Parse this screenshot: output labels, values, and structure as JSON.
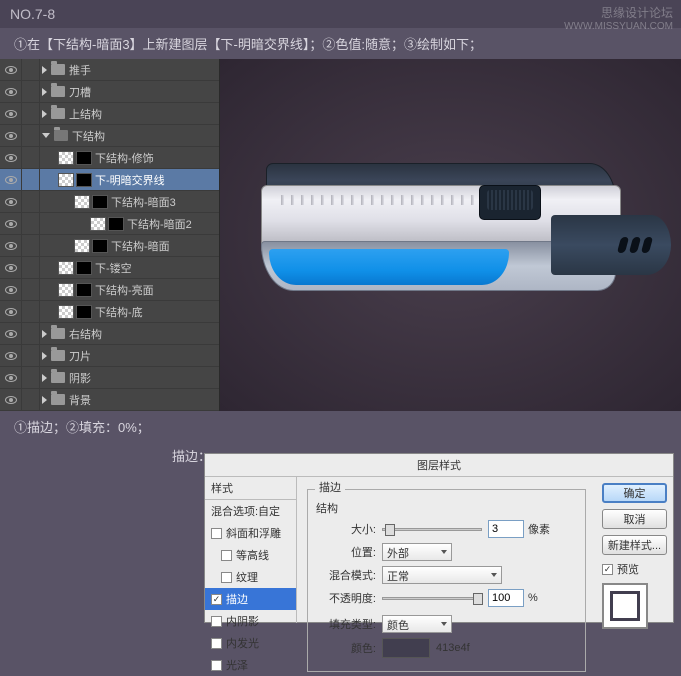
{
  "step_number": "NO.7-8",
  "watermark": {
    "line1": "思缘设计论坛",
    "line2": "WWW.MISSYUAN.COM"
  },
  "instruction": "①在【下结构-暗面3】上新建图层【下-明暗交界线】；②色值:随意；③绘制如下；",
  "stroke_info": "①描边；②填充：0%；",
  "dialog_label": "描边：",
  "layers": [
    {
      "name": "推手",
      "type": "folder",
      "indent": 0,
      "open": false,
      "vis": true
    },
    {
      "name": "刀槽",
      "type": "folder",
      "indent": 0,
      "open": false,
      "vis": true
    },
    {
      "name": "上结构",
      "type": "folder",
      "indent": 0,
      "open": false,
      "vis": true
    },
    {
      "name": "下结构",
      "type": "folder",
      "indent": 0,
      "open": true,
      "vis": true
    },
    {
      "name": "下结构-修饰",
      "type": "layer",
      "indent": 1,
      "vis": true,
      "mask": true
    },
    {
      "name": "下-明暗交界线",
      "type": "layer",
      "indent": 1,
      "vis": true,
      "mask": true,
      "selected": true
    },
    {
      "name": "下结构-暗面3",
      "type": "layer",
      "indent": 2,
      "vis": true,
      "mask": true
    },
    {
      "name": "下结构-暗面2",
      "type": "layer",
      "indent": 3,
      "vis": true,
      "mask": true
    },
    {
      "name": "下结构-暗面",
      "type": "layer",
      "indent": 2,
      "vis": true,
      "mask": true
    },
    {
      "name": "下-镂空",
      "type": "layer",
      "indent": 1,
      "vis": true,
      "mask": true
    },
    {
      "name": "下结构-亮面",
      "type": "layer",
      "indent": 1,
      "vis": true,
      "mask": true
    },
    {
      "name": "下结构-底",
      "type": "layer",
      "indent": 1,
      "vis": true,
      "mask": true
    },
    {
      "name": "右结构",
      "type": "folder",
      "indent": 0,
      "open": false,
      "vis": true
    },
    {
      "name": "刀片",
      "type": "folder",
      "indent": 0,
      "open": false,
      "vis": true
    },
    {
      "name": "阴影",
      "type": "folder",
      "indent": 0,
      "open": false,
      "vis": true
    },
    {
      "name": "背景",
      "type": "folder",
      "indent": 0,
      "open": false,
      "vis": true
    }
  ],
  "dialog": {
    "title": "图层样式",
    "styles_header": "样式",
    "blend_options": "混合选项:自定",
    "style_items": [
      {
        "label": "斜面和浮雕",
        "checked": false
      },
      {
        "label": "等高线",
        "checked": false,
        "indent": true
      },
      {
        "label": "纹理",
        "checked": false,
        "indent": true
      },
      {
        "label": "描边",
        "checked": true,
        "selected": true
      },
      {
        "label": "内阴影",
        "checked": false
      },
      {
        "label": "内发光",
        "checked": false
      },
      {
        "label": "光泽",
        "checked": false
      }
    ],
    "section_stroke": "描边",
    "section_structure": "结构",
    "size_label": "大小:",
    "size_value": "3",
    "size_unit": "像素",
    "position_label": "位置:",
    "position_value": "外部",
    "blend_mode_label": "混合模式:",
    "blend_mode_value": "正常",
    "opacity_label": "不透明度:",
    "opacity_value": "100",
    "opacity_unit": "%",
    "fill_type_label": "填充类型:",
    "fill_type_value": "颜色",
    "color_label": "颜色:",
    "color_hex": "413e4f",
    "buttons": {
      "ok": "确定",
      "cancel": "取消",
      "new_style": "新建样式...",
      "preview": "预览"
    }
  }
}
